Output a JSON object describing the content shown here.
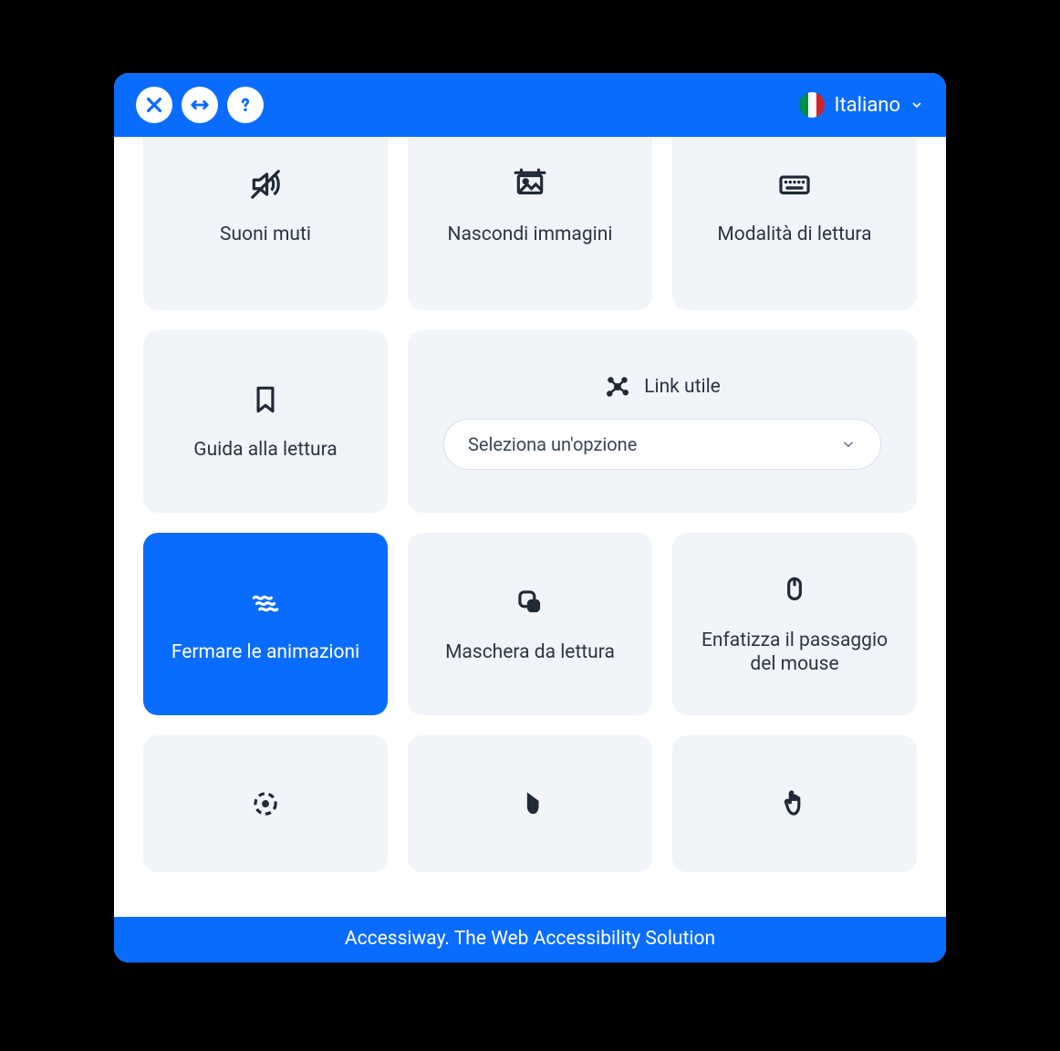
{
  "header": {
    "language_label": "Italiano"
  },
  "tiles": {
    "mute_sounds": "Suoni muti",
    "hide_images": "Nascondi immagini",
    "reading_mode": "Modalità di lettura",
    "reading_guide": "Guida alla lettura",
    "useful_link": "Link utile",
    "select_placeholder": "Seleziona un'opzione",
    "stop_animations": "Fermare le animazioni",
    "reading_mask": "Maschera da lettura",
    "highlight_hover": "Enfatizza il passaggio del mouse"
  },
  "footer": {
    "text": "Accessiway. The Web Accessibility Solution"
  }
}
